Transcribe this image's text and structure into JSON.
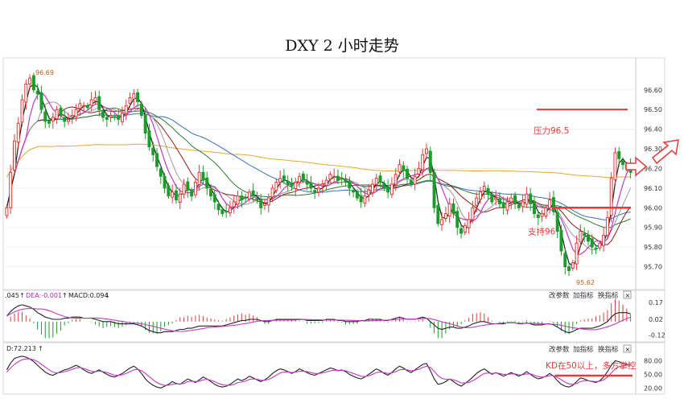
{
  "title": "DXY 2 小时走势",
  "buttons": {
    "params": "改参数",
    "add_indicator": "加指标",
    "switch_indicator": "换指标",
    "close": "×"
  },
  "macd_header": {
    "dif": ".045",
    "dea": "DEA:-0.001",
    "macd": "MACD:0.094"
  },
  "kdj_header": {
    "d": "D:72.213"
  },
  "annotations": {
    "resistance": "压力96.5",
    "support": "支持96",
    "kd": "KD在50以上，多方掌控",
    "high_label": "96.69",
    "low_label": "95.62"
  },
  "colors": {
    "up": "#e6383a",
    "down": "#1a9c2a",
    "annotation": "#e23b3b",
    "ma_black": "#222222",
    "ma_magenta": "#c23ac2",
    "ma_gray": "#9a9a9a",
    "ma_darkred": "#8b1a1a",
    "ma_green": "#2e7d32",
    "ma_blue": "#3a6fb5",
    "ma_orange": "#e3a73a"
  },
  "chart_data": [
    {
      "type": "candlestick",
      "title": "",
      "price_ticks": [
        "96.60",
        "96.50",
        "96.40",
        "96.30",
        "96.20",
        "96.10",
        "96.00",
        "95.90",
        "95.80",
        "95.70"
      ],
      "ylim": [
        95.6,
        96.73
      ],
      "resistance": 96.5,
      "support": 96.0,
      "high": 96.69,
      "low": 95.62,
      "close_values": [
        96.0,
        96.18,
        96.34,
        96.43,
        96.55,
        96.63,
        96.66,
        96.6,
        96.58,
        96.5,
        96.44,
        96.43,
        96.46,
        96.5,
        96.47,
        96.44,
        96.45,
        96.47,
        96.5,
        96.53,
        96.52,
        96.51,
        96.55,
        96.56,
        96.5,
        96.46,
        96.45,
        96.47,
        96.46,
        96.45,
        96.48,
        96.52,
        96.56,
        96.58,
        96.54,
        96.47,
        96.38,
        96.31,
        96.27,
        96.21,
        96.16,
        96.1,
        96.06,
        96.08,
        96.04,
        96.07,
        96.12,
        96.09,
        96.06,
        96.13,
        96.18,
        96.14,
        96.1,
        96.06,
        96.03,
        95.99,
        95.97,
        95.98,
        96.0,
        96.03,
        96.06,
        96.04,
        96.05,
        96.08,
        96.06,
        96.04,
        96.0,
        96.02,
        96.05,
        96.1,
        96.13,
        96.15,
        96.14,
        96.12,
        96.11,
        96.13,
        96.16,
        96.14,
        96.12,
        96.1,
        96.08,
        96.1,
        96.12,
        96.14,
        96.17,
        96.16,
        96.14,
        96.15,
        96.13,
        96.1,
        96.08,
        96.05,
        96.03,
        96.06,
        96.09,
        96.12,
        96.15,
        96.13,
        96.1,
        96.08,
        96.12,
        96.17,
        96.22,
        96.19,
        96.15,
        96.12,
        96.16,
        96.2,
        96.27,
        96.3,
        96.18,
        96.0,
        95.92,
        95.94,
        95.97,
        96.02,
        95.97,
        95.9,
        95.87,
        95.91,
        95.94,
        96.0,
        96.05,
        96.08,
        96.11,
        96.07,
        96.03,
        96.05,
        96.02,
        96.0,
        96.03,
        96.05,
        96.02,
        96.0,
        96.03,
        96.07,
        96.02,
        95.97,
        95.95,
        95.97,
        96.0,
        96.04,
        95.98,
        95.88,
        95.78,
        95.7,
        95.68,
        95.72,
        95.82,
        95.88,
        95.86,
        95.83,
        95.8,
        95.79,
        95.82,
        95.86,
        95.95,
        96.15,
        96.28,
        96.25,
        96.22,
        96.2,
        96.18
      ],
      "price_axis_side": "right"
    },
    {
      "type": "macd",
      "ticks": [
        "0.17",
        "0.02",
        "-0.12"
      ],
      "ylim": [
        -0.16,
        0.2
      ],
      "values": [
        0.05,
        0.09,
        0.12,
        0.14,
        0.15,
        0.14,
        0.13,
        0.11,
        0.08,
        0.06,
        0.04,
        0.03,
        0.02,
        0.02,
        0.02,
        0.03,
        0.03,
        0.04,
        0.04,
        0.04,
        0.03,
        0.03,
        0.03,
        0.02,
        0.01,
        0.0,
        0.0,
        0.0,
        -0.01,
        -0.02,
        -0.02,
        -0.02,
        -0.02,
        -0.02,
        -0.03,
        -0.04,
        -0.06,
        -0.08,
        -0.09,
        -0.1,
        -0.1,
        -0.09,
        -0.09,
        -0.09,
        -0.08,
        -0.07,
        -0.07,
        -0.06,
        -0.06,
        -0.05,
        -0.04,
        -0.04,
        -0.04,
        -0.04,
        -0.04,
        -0.04,
        -0.04,
        -0.03,
        -0.02,
        -0.01,
        0.0,
        0.01,
        0.01,
        0.02,
        0.02,
        0.02,
        0.01,
        0.0,
        0.0,
        0.01,
        0.02,
        0.02,
        0.02,
        0.02,
        0.02,
        0.02,
        0.02,
        0.02,
        0.01,
        0.01,
        0.01,
        0.01,
        0.01,
        0.02,
        0.02,
        0.02,
        0.01,
        0.01,
        0.0,
        0.0,
        0.0,
        0.0,
        0.01,
        0.01,
        0.02,
        0.02,
        0.02,
        0.02,
        0.01,
        0.01,
        0.02,
        0.03,
        0.04,
        0.03,
        0.02,
        0.02,
        0.02,
        0.03,
        0.04,
        0.03,
        0.0,
        -0.03,
        -0.06,
        -0.07,
        -0.06,
        -0.05,
        -0.05,
        -0.06,
        -0.06,
        -0.05,
        -0.04,
        -0.02,
        -0.01,
        0.0,
        0.0,
        -0.01,
        -0.02,
        -0.02,
        -0.02,
        -0.02,
        -0.01,
        -0.01,
        -0.01,
        -0.02,
        -0.02,
        -0.01,
        -0.02,
        -0.03,
        -0.03,
        -0.03,
        -0.02,
        -0.02,
        -0.03,
        -0.05,
        -0.07,
        -0.09,
        -0.1,
        -0.09,
        -0.07,
        -0.06,
        -0.06,
        -0.06,
        -0.06,
        -0.05,
        -0.04,
        -0.02,
        0.0,
        0.04,
        0.07,
        0.08,
        0.08,
        0.08,
        0.07
      ]
    },
    {
      "type": "kdj",
      "ticks": [
        "80.00",
        "50.00",
        "20.00"
      ],
      "ylim": [
        10,
        95
      ],
      "k": [
        60,
        75,
        85,
        88,
        90,
        88,
        84,
        78,
        70,
        62,
        55,
        50,
        48,
        52,
        56,
        60,
        62,
        66,
        70,
        66,
        60,
        55,
        52,
        56,
        60,
        55,
        50,
        46,
        44,
        48,
        52,
        58,
        64,
        68,
        62,
        52,
        40,
        32,
        26,
        22,
        20,
        24,
        28,
        34,
        30,
        28,
        34,
        40,
        36,
        32,
        38,
        44,
        40,
        34,
        28,
        24,
        22,
        24,
        28,
        34,
        40,
        36,
        40,
        46,
        42,
        38,
        34,
        38,
        44,
        52,
        58,
        62,
        60,
        56,
        52,
        56,
        62,
        58,
        54,
        50,
        48,
        52,
        56,
        60,
        64,
        62,
        58,
        60,
        56,
        50,
        46,
        42,
        40,
        44,
        50,
        56,
        62,
        58,
        52,
        48,
        54,
        62,
        68,
        64,
        58,
        54,
        60,
        66,
        72,
        74,
        58,
        40,
        28,
        30,
        34,
        40,
        34,
        28,
        24,
        30,
        36,
        44,
        52,
        58,
        62,
        56,
        50,
        54,
        50,
        46,
        50,
        54,
        50,
        46,
        50,
        56,
        50,
        44,
        40,
        42,
        46,
        52,
        46,
        36,
        28,
        24,
        22,
        26,
        34,
        42,
        40,
        36,
        34,
        32,
        36,
        44,
        56,
        70,
        80,
        78,
        74,
        72,
        70
      ],
      "d": [
        55,
        64,
        72,
        78,
        82,
        84,
        84,
        82,
        78,
        72,
        66,
        60,
        55,
        53,
        54,
        56,
        58,
        61,
        64,
        65,
        63,
        60,
        57,
        56,
        57,
        56,
        54,
        51,
        48,
        48,
        49,
        52,
        56,
        60,
        61,
        58,
        52,
        45,
        38,
        32,
        28,
        26,
        26,
        28,
        29,
        29,
        30,
        34,
        35,
        34,
        35,
        38,
        39,
        37,
        34,
        30,
        27,
        26,
        26,
        28,
        32,
        33,
        35,
        39,
        40,
        39,
        37,
        37,
        39,
        43,
        48,
        53,
        55,
        55,
        54,
        55,
        57,
        57,
        56,
        54,
        52,
        52,
        53,
        55,
        58,
        59,
        59,
        59,
        58,
        55,
        52,
        49,
        46,
        45,
        47,
        50,
        54,
        55,
        54,
        52,
        53,
        56,
        60,
        61,
        60,
        58,
        59,
        61,
        65,
        68,
        65,
        57,
        47,
        41,
        39,
        39,
        38,
        35,
        31,
        31,
        32,
        36,
        41,
        47,
        52,
        53,
        52,
        53,
        52,
        50,
        50,
        51,
        51,
        49,
        49,
        51,
        51,
        48,
        45,
        44,
        45,
        47,
        47,
        43,
        38,
        33,
        29,
        28,
        30,
        34,
        36,
        36,
        35,
        34,
        35,
        38,
        44,
        53,
        62,
        67,
        69,
        70,
        72
      ]
    }
  ]
}
